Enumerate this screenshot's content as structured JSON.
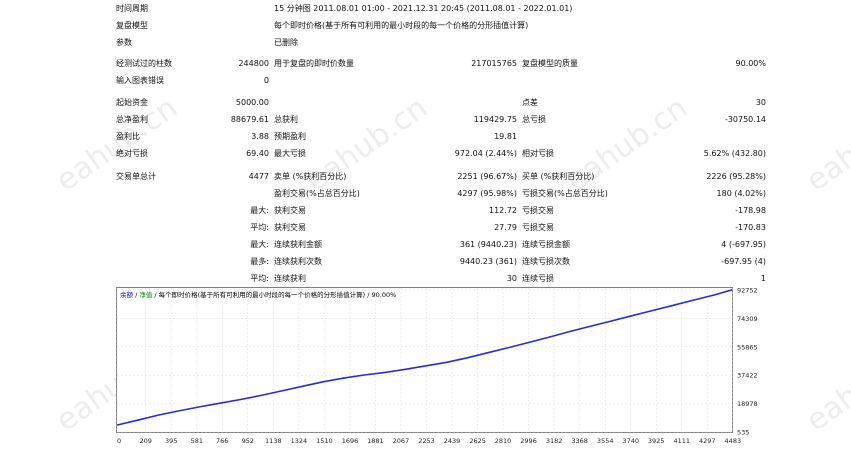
{
  "watermark": "eahub.cn",
  "report": {
    "period_label": "时间周期",
    "period_value": "15 分钟图 2011.08.01 01:00 - 2021.12.31 20:45 (2011.08.01 - 2022.01.01)",
    "model_label": "复盘模型",
    "model_value": "每个即时价格(基于所有可利用的最小时段的每一个价格的分形插值计算)",
    "params_label": "参数",
    "params_value": "已删除",
    "bars_label": "经测试过的柱数",
    "bars_value": "244800",
    "ticks_label": "用于复盘的即时价数量",
    "ticks_value": "217015765",
    "quality_label": "复盘模型的质量",
    "quality_value": "90.00%",
    "errors_label": "输入图表错误",
    "errors_value": "0",
    "deposit_label": "起始资金",
    "deposit_value": "5000.00",
    "spread_label": "点差",
    "spread_value": "30",
    "net_label": "总净盈利",
    "net_value": "88679.61",
    "gross_profit_label": "总获利",
    "gross_profit_value": "119429.75",
    "gross_loss_label": "总亏损",
    "gross_loss_value": "-30750.14",
    "pf_label": "盈利比",
    "pf_value": "3.88",
    "payoff_label": "预期盈利",
    "payoff_value": "19.81",
    "abs_dd_label": "绝对亏损",
    "abs_dd_value": "69.40",
    "max_dd_label": "最大亏损",
    "max_dd_value": "972.04 (2.44%)",
    "rel_dd_label": "相对亏损",
    "rel_dd_value": "5.62% (432.80)",
    "trades_label": "交易单总计",
    "trades_value": "4477",
    "short_label": "卖单 (%获利百分比)",
    "short_value": "2251 (96.67%)",
    "long_label": "买单 (%获利百分比)",
    "long_value": "2226 (95.28%)",
    "profit_trades_label": "盈利交易(%占总百分比)",
    "profit_trades_value": "4297 (95.98%)",
    "loss_trades_label": "亏损交易(%占总百分比)",
    "loss_trades_value": "180 (4.02%)",
    "largest_label": "最大:",
    "largest_profit_label": "获利交易",
    "largest_profit_value": "112.72",
    "largest_loss_label": "亏损交易",
    "largest_loss_value": "-178.98",
    "average_label": "平均:",
    "average_profit_label": "获利交易",
    "average_profit_value": "27.79",
    "average_loss_label": "亏损交易",
    "average_loss_value": "-170.83",
    "max_consec_label": "最大:",
    "max_consec_wins_label": "连续获利金额",
    "max_consec_wins_value": "361 (9440.23)",
    "max_consec_losses_label": "连续亏损金额",
    "max_consec_losses_value": "4 (-697.95)",
    "maximal_label": "最多:",
    "maximal_profit_label": "连续获利次数",
    "maximal_profit_value": "9440.23 (361)",
    "maximal_loss_label": "连续亏损次数",
    "maximal_loss_value": "-697.95 (4)",
    "avg_consec_label": "平均:",
    "avg_consec_wins_label": "连续获利",
    "avg_consec_wins_value": "30",
    "avg_consec_losses_label": "连续亏损",
    "avg_consec_losses_value": "1"
  },
  "chart_header": {
    "balance_label": "余额",
    "sep1": " / ",
    "equity_label": "净值",
    "rest": " / 每个即时价格(基于所有可利用的最小时段的每一个价格的分形插值计算) / 90.00%"
  },
  "chart_data": {
    "type": "line",
    "x_ticks": [
      "0",
      "209",
      "395",
      "581",
      "766",
      "952",
      "1138",
      "1324",
      "1510",
      "1696",
      "1881",
      "2067",
      "2253",
      "2439",
      "2625",
      "2810",
      "2996",
      "3182",
      "3368",
      "3554",
      "3740",
      "3925",
      "4111",
      "4297",
      "4483"
    ],
    "y_ticks": [
      "92752",
      "74309",
      "55865",
      "37422",
      "18978",
      "535"
    ],
    "xlim": [
      0,
      4477
    ],
    "ylim": [
      535,
      94000
    ],
    "colors": {
      "balance": "#2a2ad4",
      "grid": "#d8d8d8",
      "header_balance": "#0000cc",
      "header_equity": "#008800"
    },
    "series": [
      {
        "name": "余额",
        "x": [
          0,
          150,
          300,
          450,
          600,
          750,
          900,
          1050,
          1200,
          1350,
          1500,
          1650,
          1800,
          1950,
          2100,
          2250,
          2400,
          2550,
          2700,
          2850,
          3000,
          3150,
          3300,
          3450,
          3600,
          3750,
          3900,
          4050,
          4200,
          4350,
          4477
        ],
        "y": [
          5000,
          8200,
          11500,
          14200,
          16800,
          19200,
          21600,
          24300,
          27200,
          30200,
          33100,
          35500,
          37500,
          39200,
          41200,
          43500,
          45800,
          48700,
          52000,
          55300,
          58700,
          62200,
          65800,
          69300,
          72600,
          76000,
          79400,
          82800,
          86200,
          89500,
          92800
        ]
      }
    ]
  }
}
